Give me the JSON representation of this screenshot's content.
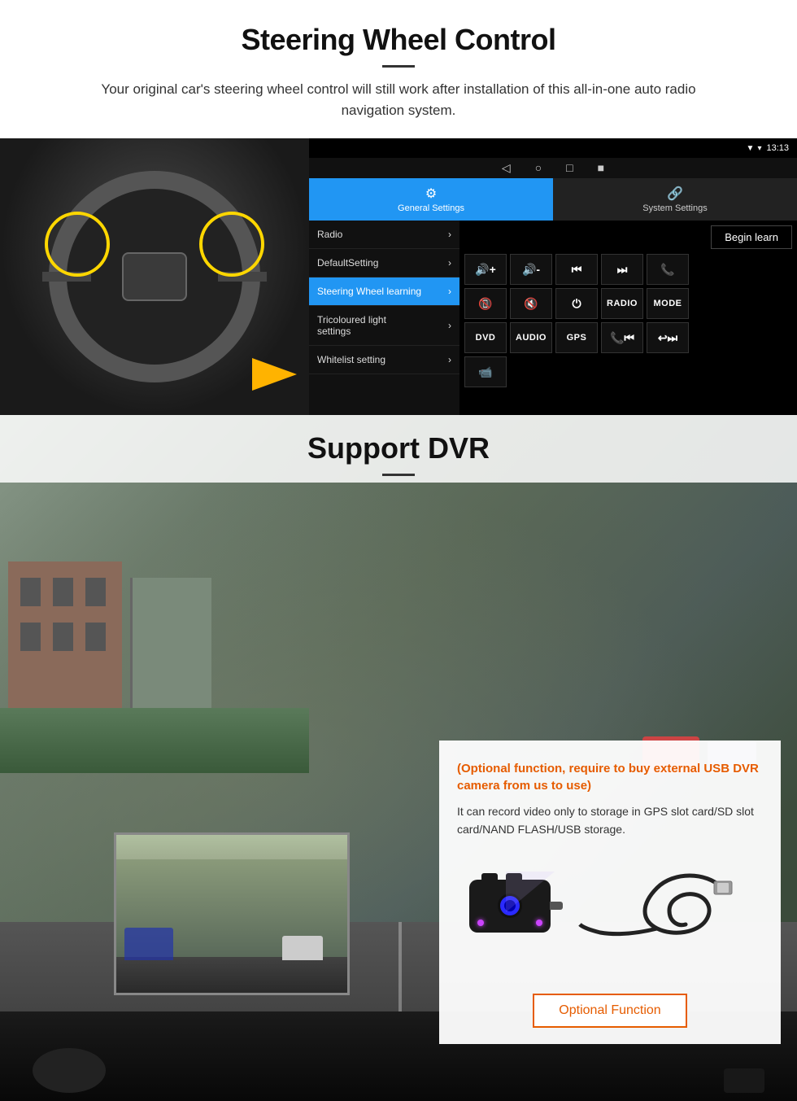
{
  "steering_section": {
    "title": "Steering Wheel Control",
    "subtitle": "Your original car's steering wheel control will still work after installation of this all-in-one auto radio navigation system.",
    "statusbar": {
      "time": "13:13",
      "signal_icon": "▼",
      "wifi_icon": "▾",
      "battery_icon": "▮"
    },
    "nav_buttons": [
      "◁",
      "○",
      "□",
      "■"
    ],
    "tabs": {
      "general": {
        "icon": "⚙",
        "label": "General Settings"
      },
      "system": {
        "icon": "🔗",
        "label": "System Settings"
      }
    },
    "menu_items": [
      {
        "label": "Radio",
        "active": false
      },
      {
        "label": "DefaultSetting",
        "active": false
      },
      {
        "label": "Steering Wheel learning",
        "active": true
      },
      {
        "label": "Tricoloured light settings",
        "active": false
      },
      {
        "label": "Whitelist setting",
        "active": false
      }
    ],
    "begin_learn_label": "Begin learn",
    "control_buttons": [
      [
        "vol+",
        "vol-",
        "prev",
        "next",
        "phone"
      ],
      [
        "hangup",
        "mute",
        "power",
        "RADIO",
        "MODE"
      ],
      [
        "DVD",
        "AUDIO",
        "GPS",
        "call-prev",
        "next-prev"
      ],
      [
        "dvr"
      ]
    ]
  },
  "dvr_section": {
    "title": "Support DVR",
    "optional_text": "(Optional function, require to buy external USB DVR camera from us to use)",
    "description": "It can record video only to storage in GPS slot card/SD slot card/NAND FLASH/USB storage.",
    "optional_btn_label": "Optional Function"
  }
}
